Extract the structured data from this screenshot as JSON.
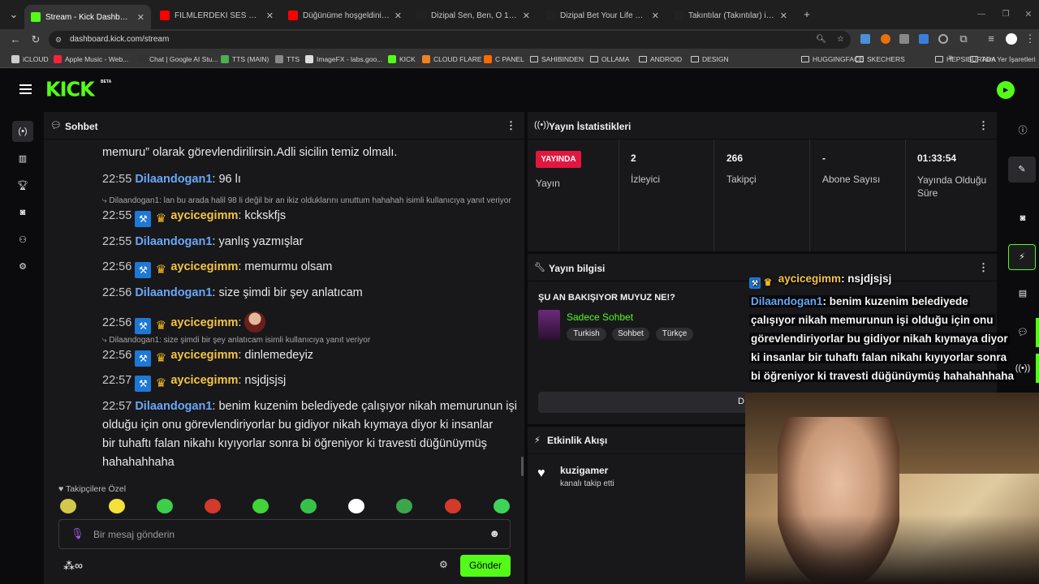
{
  "browser": {
    "tabs": [
      {
        "title": "Stream - Kick Dashboard",
        "fav": "#53fc18",
        "active": true
      },
      {
        "title": "FİLMLERDEKİ SES EFEKTLERİ NA",
        "fav": "#ff0000",
        "active": false
      },
      {
        "title": "Düğünüme hoşgeldiniz 💍😂(B",
        "fav": "#ff0000",
        "active": false
      },
      {
        "title": "Dizipal Sen, Ben, O 1.Sezon 2.B",
        "fav": "#222222",
        "active": false
      },
      {
        "title": "Dizipal Bet Your Life 1.Sezon 1.B",
        "fav": "#222222",
        "active": false
      },
      {
        "title": "Takıntılar (Takıntılar) izle - Dizip",
        "fav": "#222222",
        "active": false
      }
    ],
    "url": "dashboard.kick.com/stream",
    "bookmarks": [
      "iCLOUD",
      "Apple Music - Web...",
      "Chat | Google AI Stu...",
      "TTS (MAIN)",
      "TTS",
      "ImageFX - labs.goo...",
      "KICK",
      "CLOUD FLARE",
      "C PANEL",
      "SAHIBINDEN",
      "OLLAMA",
      "ANDROID",
      "DESIGN",
      "HUGGINGFACE",
      "SKECHERS",
      "HEPSIBURADA"
    ],
    "bookmarks_more": "»",
    "all_bookmarks": "Tüm Yer İşaretleri"
  },
  "kick": {
    "logo": "KICK",
    "beta": "BETA",
    "accent": "#53fc18"
  },
  "chat": {
    "title": "Sohbet",
    "partial_line": "memuru” olarak görevlendirilirsin.Adli sicilin temiz olmalı.",
    "messages": [
      {
        "time": "22:55",
        "user": "Dilaandogan1",
        "text": "96 lı"
      },
      {
        "time": "22:55",
        "user": "aycicegimm",
        "text": "kckskfjs",
        "reply": "Dilaandogan1: lan bu arada halil 98 li değil bir an ikiz olduklarını unuttum hahahah isimli kullanıcıya yanıt veriyor"
      },
      {
        "time": "22:55",
        "user": "Dilaandogan1",
        "text": "yanlış yazmışlar"
      },
      {
        "time": "22:56",
        "user": "aycicegimm",
        "text": "memurmu olsam"
      },
      {
        "time": "22:56",
        "user": "Dilaandogan1",
        "text": "size şimdi bir şey anlatıcam"
      },
      {
        "time": "22:56",
        "user": "aycicegimm",
        "text": ""
      },
      {
        "time": "22:56",
        "user": "aycicegimm",
        "text": "dinlemedeyiz",
        "reply": "Dilaandogan1: size şimdi bir şey anlatıcam isimli kullanıcıya yanıt veriyor"
      },
      {
        "time": "22:57",
        "user": "aycicegimm",
        "text": "nsjdjsjsj"
      },
      {
        "time": "22:57",
        "user": "Dilaandogan1",
        "text": "benim kuzenim belediyede çalışıyor nikah memurunun işi",
        "text2": "olduğu için onu görevlendiriyorlar bu gidiyor nikah kıymaya diyor ki insanlar",
        "text3": "bir tuhaftı falan nikahı kıyıyorlar sonra bi öğreniyor ki travesti düğünüymüş",
        "text4": "hahahahhaha"
      }
    ],
    "followers_only": "Takipçilere Özel",
    "placeholder": "Bir mesaj gönderin",
    "send": "Gönder"
  },
  "stats": {
    "title": "Yayın İstatistikleri",
    "live_badge": "YAYINDA",
    "items": [
      {
        "value": "",
        "label": "Yayın"
      },
      {
        "value": "2",
        "label": "İzleyici"
      },
      {
        "value": "266",
        "label": "Takipçi"
      },
      {
        "value": "-",
        "label": "Abone Sayısı"
      },
      {
        "value": "01:33:54",
        "label": "Yayında Olduğu Süre"
      }
    ]
  },
  "info": {
    "title": "Yayın bilgisi",
    "stream_title": "ŞU AN BAKIŞIYOR MUYUZ NE!?",
    "category": "Sadece Sohbet",
    "tags": [
      "Turkish",
      "Sohbet",
      "Türkçe"
    ],
    "button_partial": "D"
  },
  "activity": {
    "title": "Etkinlik Akışı",
    "user": "kuzigamer",
    "action": "kanalı takip etti"
  },
  "overlay": {
    "line1_user": "aycicegimm",
    "line1_text": ": nsjdjsjsj",
    "line2_user": "Dilaandogan1",
    "line2_text": ": benim kuzenim belediyede",
    "line3": "çalışıyor nikah memurunun işi olduğu için onu",
    "line4": "görevlendiriyorlar bu gidiyor nikah kıymaya diyor",
    "line5": "ki insanlar bir tuhaftı falan nikahı kıyıyorlar sonra",
    "line6": "bi öğreniyor ki travesti düğünüymüş hahahahhaha"
  }
}
